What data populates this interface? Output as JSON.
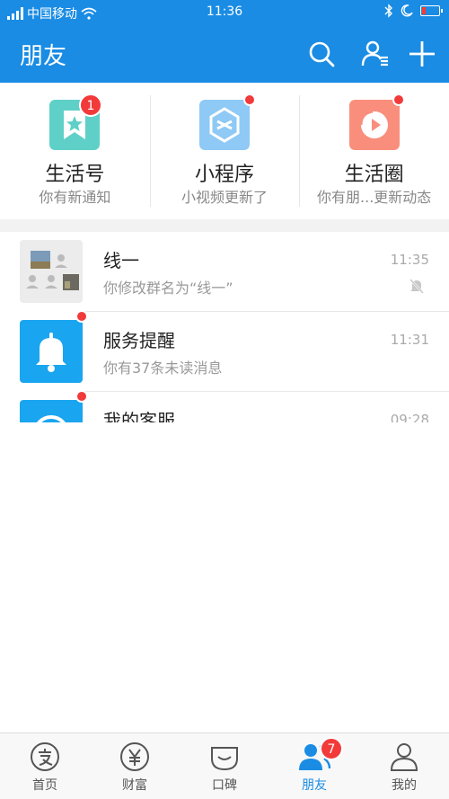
{
  "status_bar": {
    "carrier": "中国移动",
    "time": "11:36",
    "icons": [
      "signal-icon",
      "wifi-icon",
      "bluetooth-icon",
      "moon-icon",
      "battery-icon"
    ]
  },
  "header": {
    "title": "朋友",
    "actions": [
      "search-icon",
      "contacts-icon",
      "add-icon"
    ]
  },
  "quick": [
    {
      "title": "生活号",
      "subtitle": "你有新通知",
      "badge": "1",
      "icon": "bookmark-star-icon",
      "color": "#5fd0c8"
    },
    {
      "title": "小程序",
      "subtitle": "小视频更新了",
      "icon": "mini-program-icon",
      "color": "#8fc9f5"
    },
    {
      "title": "生活圈",
      "subtitle": "你有朋...更新动态",
      "icon": "life-circle-icon",
      "color": "#f98e7d"
    }
  ],
  "chats": [
    {
      "name": "线一",
      "message": "你修改群名为“线一”",
      "time": "11:35",
      "muted": true,
      "icon": "group-avatar-icon"
    },
    {
      "name": "服务提醒",
      "message": "你有37条未读消息",
      "time": "11:31",
      "icon": "bell-icon",
      "color": "#1aa5f0"
    },
    {
      "name": "我的客服",
      "message": "",
      "time": "09:28",
      "icon": "customer-service-icon",
      "color": "#1aa5f0"
    }
  ],
  "tabs": [
    {
      "label": "首页",
      "icon": "alipay-home-icon"
    },
    {
      "label": "财富",
      "icon": "yen-icon"
    },
    {
      "label": "口碑",
      "icon": "koubei-icon"
    },
    {
      "label": "朋友",
      "icon": "friends-icon",
      "badge": "7",
      "active": true
    },
    {
      "label": "我的",
      "icon": "profile-icon"
    }
  ],
  "colors": {
    "brand": "#1a8ce4",
    "badge": "#f23a3a"
  }
}
